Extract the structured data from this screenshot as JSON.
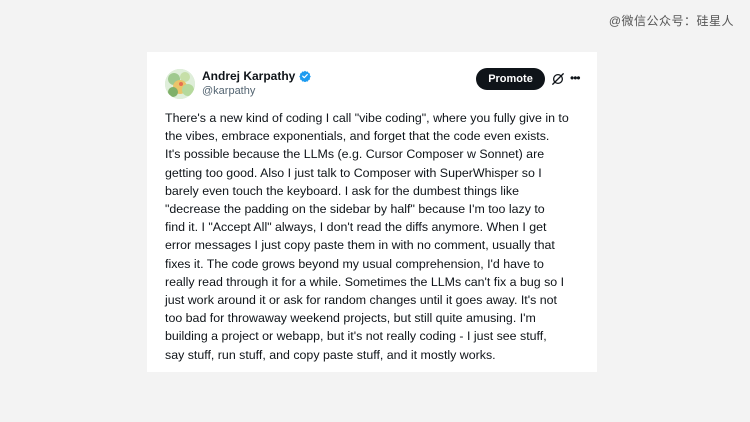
{
  "watermark": "@微信公众号：硅星人",
  "author": {
    "name": "Andrej Karpathy",
    "handle": "@karpathy"
  },
  "actions": {
    "promote_label": "Promote",
    "grok_icon": "grok-icon",
    "more_icon": "more-icon"
  },
  "colors": {
    "verified_blue": "#1d9bf0",
    "promote_bg": "#0f1419",
    "text": "#0f1419",
    "handle": "#536471"
  },
  "tweet": {
    "lines": [
      "There's a new kind of coding I call \"vibe coding\", where you fully give in to",
      "the vibes, embrace exponentials, and forget that the code even exists.",
      "It's possible because the LLMs (e.g. Cursor Composer w Sonnet) are",
      "getting too good. Also I just talk to Composer with SuperWhisper so I",
      "barely even touch the keyboard. I ask for the dumbest things like",
      "\"decrease the padding on the sidebar by half\" because I'm too lazy to",
      "find it. I \"Accept All\" always, I don't read the diffs anymore. When I get",
      "error messages I just copy paste them in with no comment, usually that",
      "fixes it. The code grows beyond my usual comprehension, I'd have to",
      "really read through it for a while. Sometimes the LLMs can't fix a bug so I",
      "just work around it or ask for random changes until it goes away. It's not",
      "too bad for throwaway weekend projects, but still quite amusing. I'm",
      "building a project or webapp, but it's not really coding - I just see stuff,",
      "say stuff, run stuff, and copy paste stuff, and it mostly works."
    ]
  }
}
